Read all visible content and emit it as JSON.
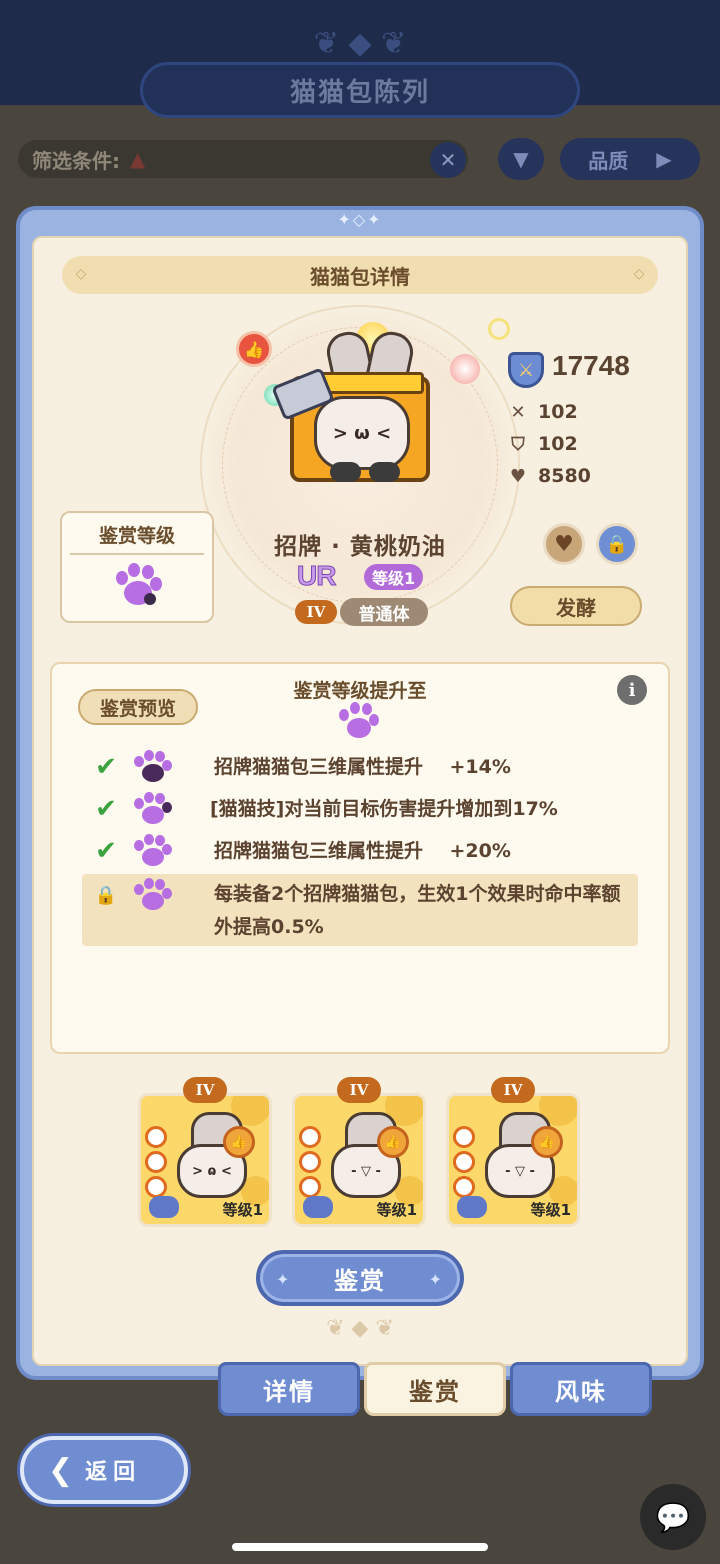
{
  "background": {
    "screen_title": "猫猫包陈列",
    "filter_label": "筛选条件:",
    "quality_label": "品质"
  },
  "panel": {
    "header": "猫猫包详情"
  },
  "character": {
    "name": "招牌 · 黄桃奶油",
    "rarity": "UR",
    "level": "等级1",
    "tier": "IV",
    "body_type": "普通体",
    "power": "17748",
    "attack": "102",
    "defense": "102",
    "hp": "8580",
    "ferment_label": "发酵"
  },
  "appraisal_level": {
    "title": "鉴赏等级"
  },
  "preview": {
    "tag": "鉴赏预览",
    "title": "鉴赏等级提升至",
    "effects": [
      {
        "status": "unlocked",
        "text": "招牌猫猫包三维属性提升    +14%"
      },
      {
        "status": "unlocked",
        "text": "[猫猫技]对当前目标伤害提升增加到17%"
      },
      {
        "status": "unlocked",
        "text": "招牌猫猫包三维属性提升    +20%"
      },
      {
        "status": "locked",
        "text": "每装备2个招牌猫猫包，生效1个效果时命中率额外提高0.5%"
      }
    ]
  },
  "slots": [
    {
      "tier": "IV",
      "level": "等级1"
    },
    {
      "tier": "IV",
      "level": "等级1"
    },
    {
      "tier": "IV",
      "level": "等级1"
    }
  ],
  "appraise_button": "鉴赏",
  "tabs": [
    {
      "label": "详情",
      "active": false
    },
    {
      "label": "鉴赏",
      "active": true
    },
    {
      "label": "风味",
      "active": false
    }
  ],
  "back_button": "返回",
  "colors": {
    "accent_blue": "#6f8dd0",
    "paw_purple": "#b76ee3",
    "check_green": "#3aa33d",
    "tier_orange": "#c46a1f"
  },
  "icons": [
    "power-shield-icon",
    "sword-icon",
    "shield-icon",
    "heart-icon",
    "favorite-heart-icon",
    "lock-icon",
    "info-icon",
    "paw-icon",
    "check-icon",
    "chat-icon",
    "back-arrow-icon",
    "filter-icon",
    "close-icon"
  ]
}
